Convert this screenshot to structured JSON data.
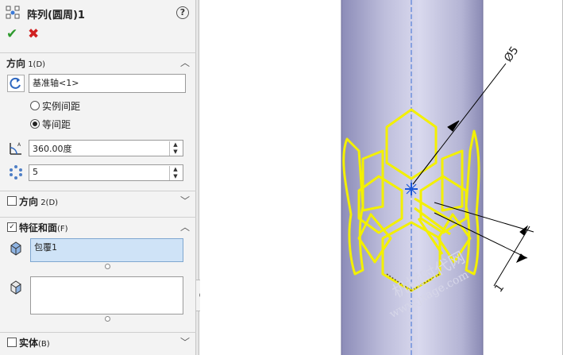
{
  "header": {
    "title": "阵列(圆周)1",
    "help": "?",
    "ok_glyph": "✔",
    "cancel_glyph": "✖"
  },
  "direction1": {
    "label": "方向",
    "label_suffix": " 1(D)",
    "axis_value": "基准轴<1>",
    "option_instance_spacing": "实例间距",
    "option_equal_spacing": "等间距",
    "selected_option": "等间距",
    "angle_value": "360.00度",
    "count_value": "5"
  },
  "direction2": {
    "label": "方向",
    "label_suffix": " 2(D)",
    "checked": false
  },
  "features": {
    "label": "特征和面",
    "label_suffix": "(F)",
    "checked": true,
    "feature_item": "包覆1",
    "faces_value": ""
  },
  "bodies": {
    "label": "实体",
    "label_suffix": "(B)",
    "checked": false
  },
  "viewport": {
    "dim_diameter": "Ø5",
    "dim_length": "1",
    "watermark_cn": "机械时代网",
    "watermark_url": "www.jxage.com"
  },
  "colors": {
    "cylinder_light": "#d9d9ee",
    "cylinder_dark": "#8c8cb8",
    "pattern_yellow": "#f3f000",
    "accent_blue": "#1a56d8"
  }
}
